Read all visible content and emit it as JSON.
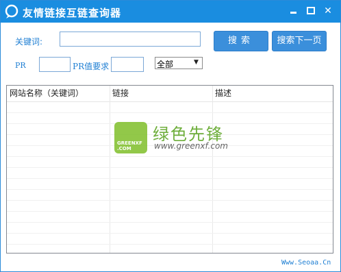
{
  "window": {
    "title": "友情链接互链查询器",
    "accent": "#1a8de0"
  },
  "search": {
    "keyword_label": "关键词:",
    "keyword_value": "",
    "search_button": "搜索",
    "next_page_button": "搜索下一页"
  },
  "filters": {
    "pr_label": "PR",
    "pr_value": "",
    "pr_requirement_label": "PR值要求",
    "pr_requirement_value": "",
    "category_selected": "全部"
  },
  "table": {
    "columns": [
      "网站名称（关键词）",
      "链接",
      "描述"
    ],
    "rows": []
  },
  "watermark": {
    "brand_cn": "绿色先锋",
    "brand_url": "www.greenxf.com",
    "logo_text_line1": "GREENXF",
    "logo_text_line2": ".COM"
  },
  "footer": {
    "site": "Www.Seoaa.Cn"
  }
}
